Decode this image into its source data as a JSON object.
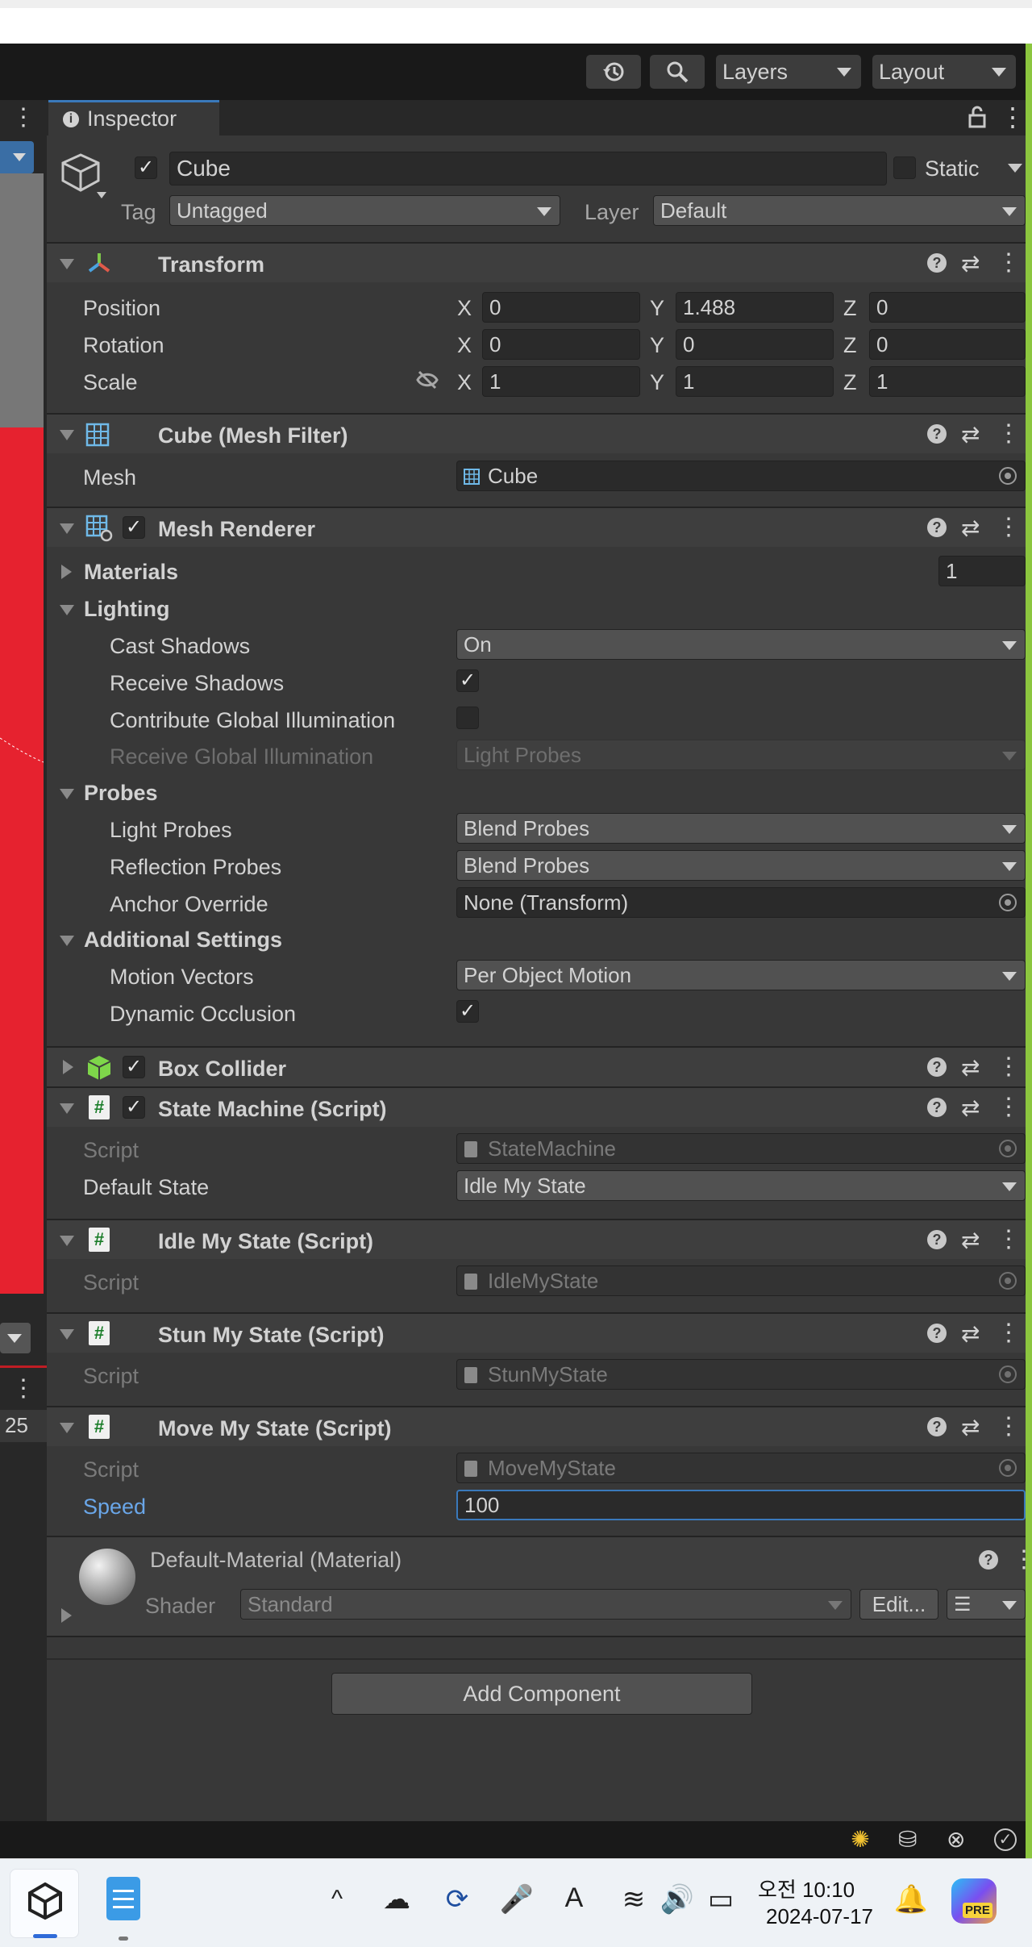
{
  "toolbar": {
    "layers": "Layers",
    "layout": "Layout",
    "history_icon": "history-icon",
    "search_icon": "search-icon"
  },
  "scene": {
    "counter": "25"
  },
  "inspector": {
    "tab": "Inspector",
    "object": {
      "name": "Cube",
      "static": "Static",
      "tag_label": "Tag",
      "tag": "Untagged",
      "layer_label": "Layer",
      "layer": "Default"
    },
    "transform": {
      "title": "Transform",
      "position": "Position",
      "rotation": "Rotation",
      "scale": "Scale",
      "x": "X",
      "y": "Y",
      "z": "Z",
      "pos": [
        "0",
        "1.488",
        "0"
      ],
      "rot": [
        "0",
        "0",
        "0"
      ],
      "scl": [
        "1",
        "1",
        "1"
      ]
    },
    "mesh_filter": {
      "title": "Cube (Mesh Filter)",
      "mesh_label": "Mesh",
      "mesh": "Cube"
    },
    "mesh_renderer": {
      "title": "Mesh Renderer",
      "materials": "Materials",
      "materials_count": "1",
      "lighting": "Lighting",
      "cast_shadows": "Cast Shadows",
      "cast_value": "On",
      "receive_shadows": "Receive Shadows",
      "contribute_gi": "Contribute Global Illumination",
      "receive_gi": "Receive Global Illumination",
      "receive_gi_value": "Light Probes",
      "probes": "Probes",
      "light_probes": "Light Probes",
      "light_probes_value": "Blend Probes",
      "reflection_probes": "Reflection Probes",
      "reflection_value": "Blend Probes",
      "anchor": "Anchor Override",
      "anchor_value": "None (Transform)",
      "additional": "Additional Settings",
      "motion_vectors": "Motion Vectors",
      "motion_value": "Per Object Motion",
      "dynamic_occlusion": "Dynamic Occlusion"
    },
    "box_collider": {
      "title": "Box Collider"
    },
    "state_machine": {
      "title": "State Machine (Script)",
      "script_label": "Script",
      "script": "StateMachine",
      "default_label": "Default State",
      "default_value": "Idle My State"
    },
    "idle": {
      "title": "Idle My State (Script)",
      "script_label": "Script",
      "script": "IdleMyState"
    },
    "stun": {
      "title": "Stun My State (Script)",
      "script_label": "Script",
      "script": "StunMyState"
    },
    "move": {
      "title": "Move My State (Script)",
      "script_label": "Script",
      "script": "MoveMyState",
      "speed_label": "Speed",
      "speed": "100"
    },
    "material": {
      "title": "Default-Material (Material)",
      "shader_label": "Shader",
      "shader": "Standard",
      "edit": "Edit..."
    },
    "add_component": "Add Component"
  },
  "taskbar": {
    "time": "오전 10:10",
    "date": "2024-07-17",
    "ime": "A",
    "copilot_badge": "PRE"
  },
  "colors": {
    "accent": "#3a79bb",
    "unity_green": "#8cc63f",
    "viewport_red": "#e6222f"
  }
}
